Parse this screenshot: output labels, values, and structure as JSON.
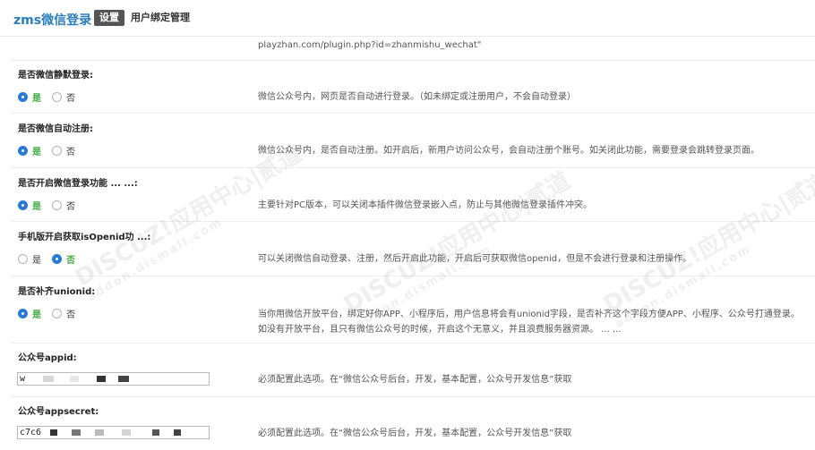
{
  "header": {
    "plugin_title": "zms微信登录",
    "tabs": [
      {
        "label": "设置",
        "active": true
      },
      {
        "label": "用户绑定管理",
        "active": false
      }
    ]
  },
  "url_line": "playzhan.com/plugin.php?id=zhanmishu_wechat\"",
  "settings": [
    {
      "label": "是否微信静默登录:",
      "options": [
        "是",
        "否"
      ],
      "selected": "是",
      "desc": "微信公众号内，网页是否自动进行登录。（如未绑定或注册用户，不会自动登录）"
    },
    {
      "label": "是否微信自动注册:",
      "options": [
        "是",
        "否"
      ],
      "selected": "是",
      "desc": "微信公众号内，是否自动注册。如开启后，新用户访问公众号，会自动注册个账号。如关闭此功能，需要登录会跳转登录页面。"
    },
    {
      "label": "是否开启微信登录功能 ... ...:",
      "options": [
        "是",
        "否"
      ],
      "selected": "是",
      "desc": "主要针对PC版本，可以关闭本插件微信登录嵌入点，防止与其他微信登录插件冲突。"
    },
    {
      "label": "手机版开启获取isOpenid功 ...:",
      "options": [
        "是",
        "否"
      ],
      "selected": "否",
      "desc": "可以关闭微信自动登录、注册，然后开启此功能，开启后可获取微信openid，但是不会进行登录和注册操作。"
    },
    {
      "label": "是否补齐unionid:",
      "options": [
        "是",
        "否"
      ],
      "selected": "是",
      "desc": "当你用微信开放平台，绑定好你APP、小程序后，用户信息将会有unionid字段，是否补齐这个字段方便APP、小程序、公众号打通登录。",
      "desc2": "如没有开放平台，且只有微信公众号的时候，开启这个无意义，并且浪费服务器资源。 ... ..."
    }
  ],
  "fields": [
    {
      "label": "公众号appid:",
      "value_prefix": "w",
      "desc": "必须配置此选项。在“微信公众号后台，开发，基本配置，公众号开发信息”获取"
    },
    {
      "label": "公众号appsecret:",
      "value_prefix": "c7c6",
      "desc": "必须配置此选项。在“微信公众号后台，开发，基本配置，公众号开发信息”获取"
    }
  ],
  "watermarks": [
    {
      "brand": "DISCUZ!应用中心|贰道",
      "site": "addon.dismall.com"
    }
  ],
  "colors": {
    "accent": "#2979d8",
    "selected_option": "#3fa93f",
    "title": "#2b7dbc"
  }
}
